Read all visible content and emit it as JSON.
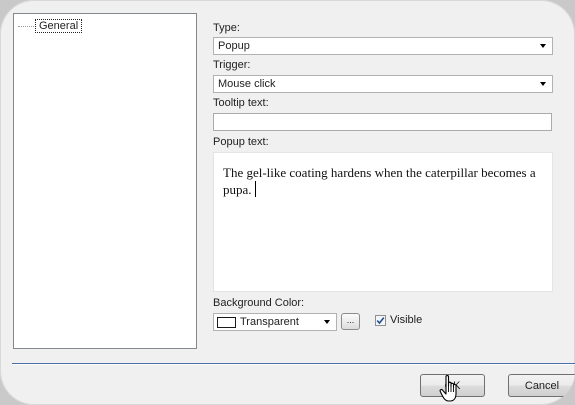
{
  "tree": {
    "items": [
      {
        "label": "General",
        "selected": true
      }
    ]
  },
  "form": {
    "type_label": "Type:",
    "type_value": "Popup",
    "trigger_label": "Trigger:",
    "trigger_value": "Mouse click",
    "tooltip_label": "Tooltip text:",
    "tooltip_value": "",
    "popup_label": "Popup text:",
    "popup_value": "The gel-like coating hardens when the caterpillar becomes a pupa.",
    "bg_color_label": "Background Color:",
    "bg_color_value": "Transparent",
    "ellipsis_label": "...",
    "visible_label": "Visible",
    "visible_checked": true
  },
  "buttons": {
    "ok_label": "OK",
    "cancel_label": "Cancel"
  },
  "icons": {
    "dropdown": "chevron-down-icon",
    "checkbox": "checkmark-icon",
    "cursor": "hand-pointer-icon",
    "swatch": "color-swatch-icon"
  },
  "colors": {
    "separator": "#4a6ea8",
    "checkmark": "#1f4f8f"
  }
}
